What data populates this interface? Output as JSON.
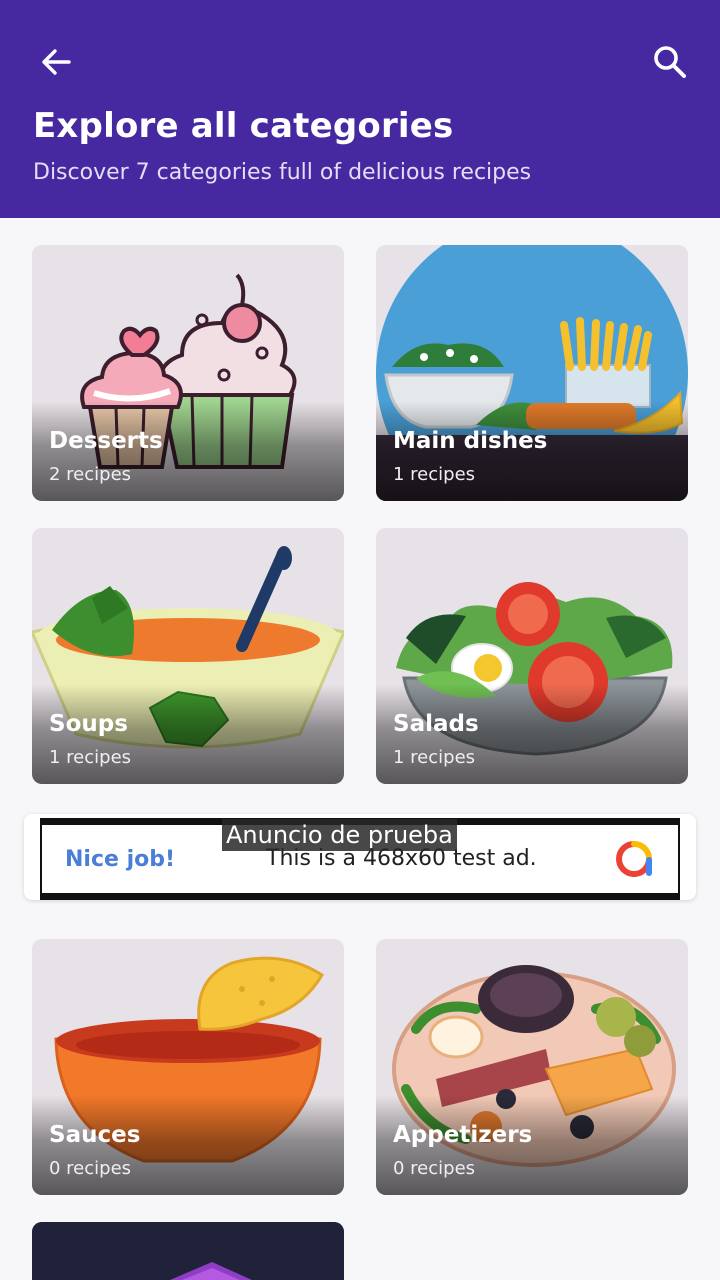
{
  "header": {
    "title": "Explore all categories",
    "subtitle": "Discover 7 categories full of delicious recipes"
  },
  "categories": [
    {
      "name": "Desserts",
      "count": "2 recipes"
    },
    {
      "name": "Main dishes",
      "count": "1 recipes"
    },
    {
      "name": "Soups",
      "count": "1 recipes"
    },
    {
      "name": "Salads",
      "count": "1 recipes"
    },
    {
      "name": "Sauces",
      "count": "0 recipes"
    },
    {
      "name": "Appetizers",
      "count": "0 recipes"
    }
  ],
  "ad": {
    "label": "Anuncio de prueba",
    "headline": "Nice job!",
    "description": "This is a 468x60 test ad."
  },
  "icons": [
    "back-arrow-icon",
    "search-icon",
    "ad-logo-icon"
  ],
  "colors": {
    "appbar": "#4629a0",
    "ad_headline": "#4a7fd6"
  }
}
